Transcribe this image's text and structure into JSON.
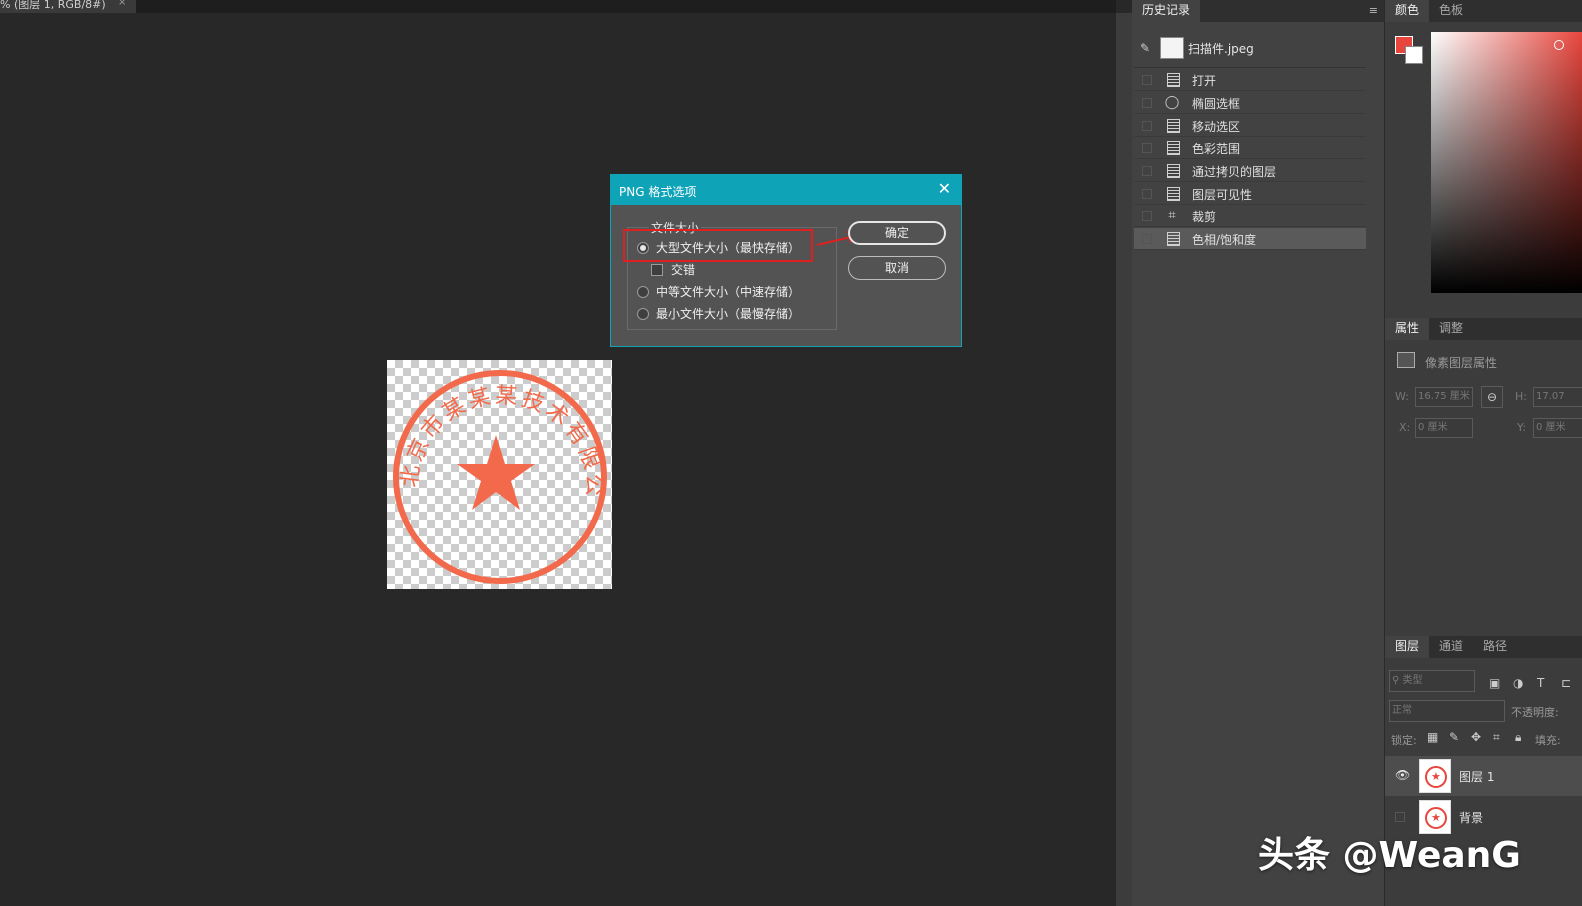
{
  "document": {
    "tab_title": "% (图层 1, RGB/8#)",
    "tab_close": "×"
  },
  "dialog": {
    "title": "PNG 格式选项",
    "close": "✕",
    "group_label": "文件大小",
    "options": [
      {
        "label": "大型文件大小（最快存储）",
        "selected": true
      },
      {
        "label": "交错",
        "checked": false
      },
      {
        "label": "中等文件大小（中速存储）",
        "selected": false
      },
      {
        "label": "最小文件大小（最慢存储）",
        "selected": false
      }
    ],
    "ok_label": "确定",
    "cancel_label": "取消",
    "annotation_color": "#e02020"
  },
  "stamp": {
    "text": "北京市某某某技术有限公司",
    "color": "#f26a4b"
  },
  "history": {
    "tabs": [
      "历史记录"
    ],
    "menu_icon": "≡",
    "snapshot": "扫描件.jpeg",
    "items": [
      {
        "label": "打开",
        "icon": "doc-icon"
      },
      {
        "label": "椭圆选框",
        "icon": "ellipse-marquee-icon"
      },
      {
        "label": "移动选区",
        "icon": "doc-icon"
      },
      {
        "label": "色彩范围",
        "icon": "doc-icon"
      },
      {
        "label": "通过拷贝的图层",
        "icon": "doc-icon"
      },
      {
        "label": "图层可见性",
        "icon": "doc-icon"
      },
      {
        "label": "裁剪",
        "icon": "crop-icon"
      },
      {
        "label": "色相/饱和度",
        "icon": "doc-icon",
        "selected": true
      }
    ]
  },
  "color_panel": {
    "tabs": [
      "颜色",
      "色板"
    ],
    "foreground": "#e8453c",
    "background": "#ffffff"
  },
  "properties": {
    "tabs": [
      "属性",
      "调整"
    ],
    "title": "像素图层属性",
    "w_label": "W:",
    "w_value": "16.75 厘米",
    "h_label": "H:",
    "h_value": "17.07",
    "x_label": "X:",
    "x_value": "0 厘米",
    "y_label": "Y:",
    "y_value": "0 厘米"
  },
  "layers": {
    "tabs": [
      "图层",
      "通道",
      "路径"
    ],
    "filter_placeholder": "类型",
    "blend_mode": "正常",
    "opacity_label": "不透明度:",
    "lock_label": "锁定:",
    "fill_label": "填充:",
    "items": [
      {
        "name": "图层 1",
        "visible": true,
        "selected": true
      },
      {
        "name": "背景",
        "visible": false,
        "selected": false
      }
    ]
  },
  "watermark": "头条 @WeanG"
}
